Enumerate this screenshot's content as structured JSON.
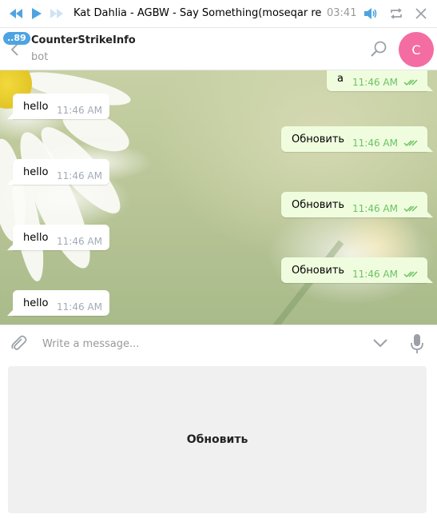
{
  "player": {
    "track": "Kat Dahlia - AGBW - Say Something(moseqar rem...",
    "time": "03:41",
    "icons": [
      "prev-icon",
      "play-icon",
      "next-icon",
      "volume-icon",
      "repeat-icon",
      "close-icon"
    ]
  },
  "header": {
    "unread_badge": "..89",
    "title": "CounterStrikeInfo",
    "subtitle": "bot",
    "avatar_letter": "C",
    "avatar_color": "#f36da3"
  },
  "messages": [
    {
      "direction": "out",
      "text": "a",
      "time": "11:46 AM"
    },
    {
      "direction": "in",
      "text": "hello",
      "time": "11:46 AM"
    },
    {
      "direction": "out",
      "text": "Обновить",
      "time": "11:46 AM"
    },
    {
      "direction": "in",
      "text": "hello",
      "time": "11:46 AM"
    },
    {
      "direction": "out",
      "text": "Обновить",
      "time": "11:46 AM"
    },
    {
      "direction": "in",
      "text": "hello",
      "time": "11:46 AM"
    },
    {
      "direction": "out",
      "text": "Обновить",
      "time": "11:46 AM"
    },
    {
      "direction": "in",
      "text": "hello",
      "time": "11:46 AM"
    }
  ],
  "compose": {
    "placeholder": "Write a message...",
    "value": ""
  },
  "keyboard": {
    "buttons": [
      "Обновить"
    ]
  },
  "colors": {
    "accent": "#4ea4e0",
    "outgoing_bubble": "#effdde",
    "read_check": "#6cc264"
  }
}
